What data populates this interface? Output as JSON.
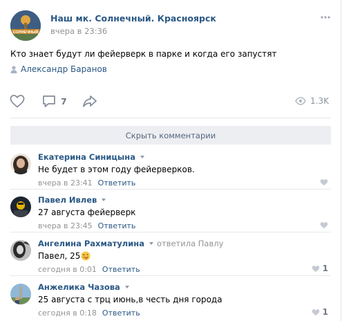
{
  "post": {
    "group_name": "Наш мк. Солнечный. Красноярск",
    "group_avatar_text": "СОЛНЕЧНЫЙ",
    "date": "вчера в 23:36",
    "text": "Кто знает будут ли фейерверк в парке и когда его запустят",
    "author": "Александр Баранов",
    "comments_count": "7",
    "views_count": "1.3K"
  },
  "hide_comments_label": "Скрыть комментарии",
  "comments": [
    {
      "name": "Екатерина Синицына",
      "reply_to": "",
      "text": "Не будет в этом году фейерверков.",
      "time": "вчера в 23:41",
      "reply_label": "Ответить",
      "likes": ""
    },
    {
      "name": "Павел Ивлев",
      "reply_to": "",
      "text": "27 августа фейерверк",
      "time": "вчера в 23:45",
      "reply_label": "Ответить",
      "likes": ""
    },
    {
      "name": "Ангелина Рахматулина",
      "reply_to": "ответила Павлу",
      "text": "Павел, 25",
      "time": "сегодня в 0:01",
      "reply_label": "Ответить",
      "likes": "1"
    },
    {
      "name": "Анжелика Чазова",
      "reply_to": "",
      "text": "25 августа с трц июнь,в честь дня города",
      "time": "сегодня в 0:18",
      "reply_label": "Ответить",
      "likes": "1"
    }
  ],
  "colors": {
    "link": "#2a5885",
    "muted": "#939393",
    "icon": "#828a99",
    "separator": "#e7e8ec",
    "hide_bg": "#edeef2"
  },
  "icons": {
    "more": "more-dots-icon",
    "author": "person-icon",
    "like": "heart-icon",
    "comment": "speech-bubble-icon",
    "share": "share-arrow-icon",
    "views": "eye-icon",
    "emoji": "tongue-wink-emoji-icon"
  }
}
